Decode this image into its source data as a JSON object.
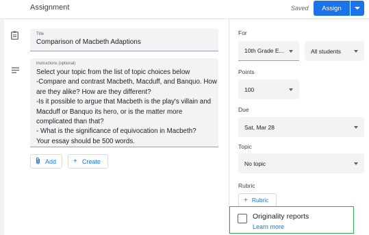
{
  "header": {
    "title": "Assignment",
    "saved_status": "Saved",
    "assign_label": "Assign",
    "assign_dropdown_icon": "caret-down-icon"
  },
  "colors": {
    "primary": "#1a73e8",
    "highlight_border": "#34a853",
    "field_bg": "#f1f3f4"
  },
  "form": {
    "title_label": "Title",
    "title_value": "Comparison of Macbeth Adaptions",
    "instructions_label": "Instructions (optional)",
    "instructions_lines": [
      "Select your topic from the list of topic choices below",
      "-Compare and contrast Macbeth, Macduff, and Banquo. How",
      "are they alike? How are they different?",
      "-Is it possible to argue that Macbeth is the play's villain and",
      "Macduff or Banquo its hero, or is the matter more",
      "complicated than that?",
      "- What is the significance of equivocation in Macbeth?",
      "Your essay should be 500 words."
    ],
    "add_label": "Add",
    "create_label": "Create"
  },
  "settings": {
    "for_label": "For",
    "class_value": "10th Grade E...",
    "students_value": "All students",
    "points_label": "Points",
    "points_value": "100",
    "due_label": "Due",
    "due_value": "Sat, Mar 28",
    "topic_label": "Topic",
    "topic_value": "No topic",
    "rubric_label": "Rubric",
    "rubric_button": "Rubric",
    "originality_title": "Originality reports",
    "originality_link": "Learn more"
  }
}
